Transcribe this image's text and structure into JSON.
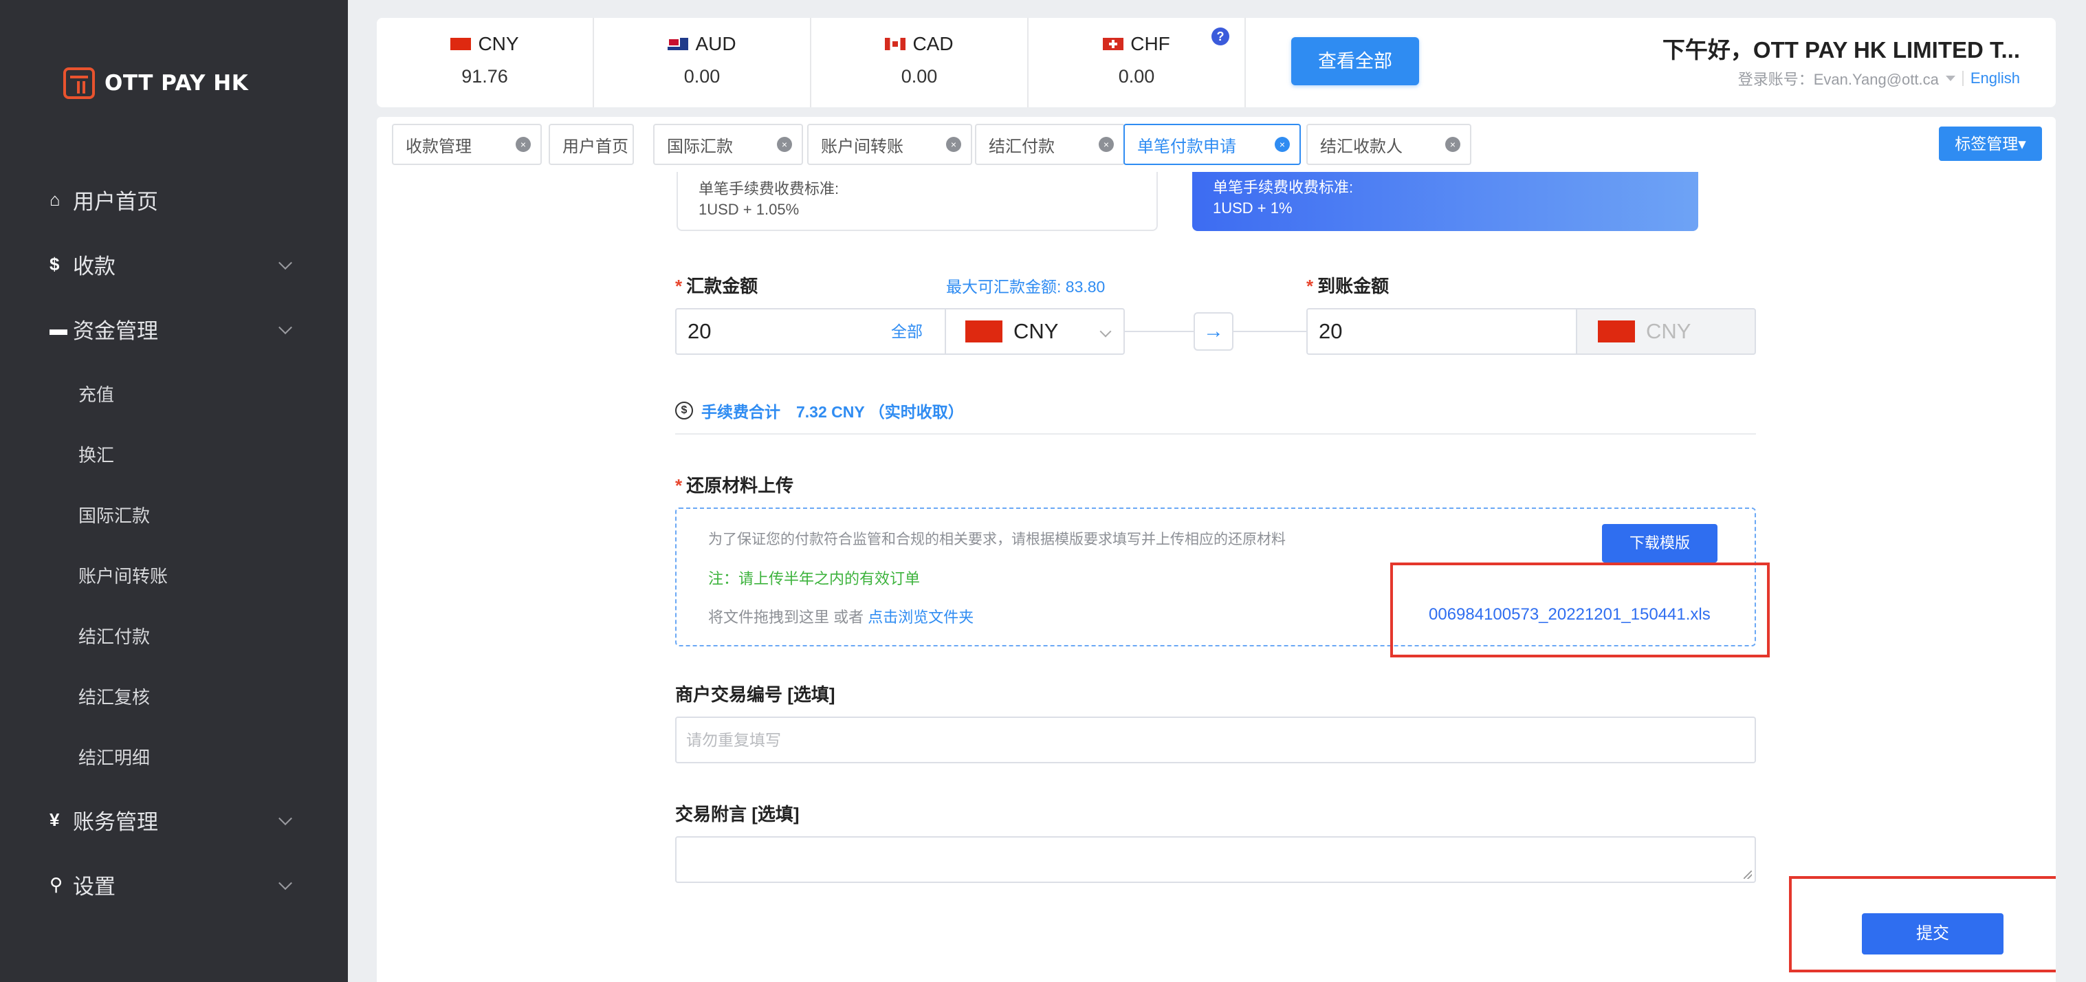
{
  "brand": {
    "name": "OTT PAY HK",
    "accent": "#2f8cf2",
    "sidebar_bg": "#2f3035",
    "highlight": "#e4372c"
  },
  "sidebar": {
    "items": [
      {
        "icon": "home-icon",
        "glyph": "⌂",
        "label": "用户首页"
      },
      {
        "icon": "dollar-icon",
        "glyph": "$",
        "label": "收款"
      },
      {
        "icon": "card-icon",
        "glyph": "▬",
        "label": "资金管理"
      },
      {
        "icon": "yen-icon",
        "glyph": "¥",
        "label": "账务管理"
      },
      {
        "icon": "search-icon",
        "glyph": "⚲",
        "label": "设置"
      }
    ],
    "sub_items": [
      "充值",
      "换汇",
      "国际汇款",
      "账户间转账",
      "结汇付款",
      "结汇复核",
      "结汇明细"
    ]
  },
  "balances": [
    {
      "code": "CNY",
      "value": "91.76"
    },
    {
      "code": "AUD",
      "value": "0.00"
    },
    {
      "code": "CAD",
      "value": "0.00"
    },
    {
      "code": "CHF",
      "value": "0.00"
    }
  ],
  "header": {
    "view_all": "查看全部",
    "help": "?",
    "greeting": "下午好，OTT PAY HK LIMITED T...",
    "account_label": "登录账号：Evan.Yang@ott.ca",
    "language": "English"
  },
  "tabs": [
    {
      "label": "收款管理",
      "close": "×"
    },
    {
      "label": "用户首页"
    },
    {
      "label": "国际汇款",
      "close": "×"
    },
    {
      "label": "账户间转账",
      "close": "×"
    },
    {
      "label": "结汇付款",
      "close": "×"
    },
    {
      "label": "单笔付款申请",
      "close": "×"
    },
    {
      "label": "结汇收款人",
      "close": "×"
    }
  ],
  "tag_manager": "标签管理▾",
  "fee_cards": [
    {
      "line1": "单笔手续费收费标准:",
      "line2": "1USD + 1.05%"
    },
    {
      "line1": "单笔手续费收费标准:",
      "line2": "1USD + 1%"
    }
  ],
  "form": {
    "required_mark": "*",
    "remit_label": "汇款金额",
    "max_amount": "最大可汇款金额: 83.80",
    "remit_value": "20",
    "all_label": "全部",
    "remit_currency": "CNY",
    "arrow": "→",
    "receive_label": "到账金额",
    "receive_value": "20",
    "receive_currency": "CNY",
    "fee_total_icon": "$",
    "fee_total": "手续费合计　7.32 CNY （实时收取）",
    "upload_label": "还原材料上传",
    "upload_desc": "为了保证您的付款符合监管和合规的相关要求，请根据模版要求填写并上传相应的还原材料",
    "upload_note": "注：请上传半年之内的有效订单",
    "upload_drag": "将文件拖拽到这里 或者 ",
    "upload_browse": "点击浏览文件夹",
    "download_template": "下载模版",
    "uploaded_file": "006984100573_20221201_150441.xls",
    "merchant_label": "商户交易编号 [选填]",
    "merchant_placeholder": "请勿重复填写",
    "memo_label": "交易附言 [选填]",
    "submit": "提交"
  }
}
